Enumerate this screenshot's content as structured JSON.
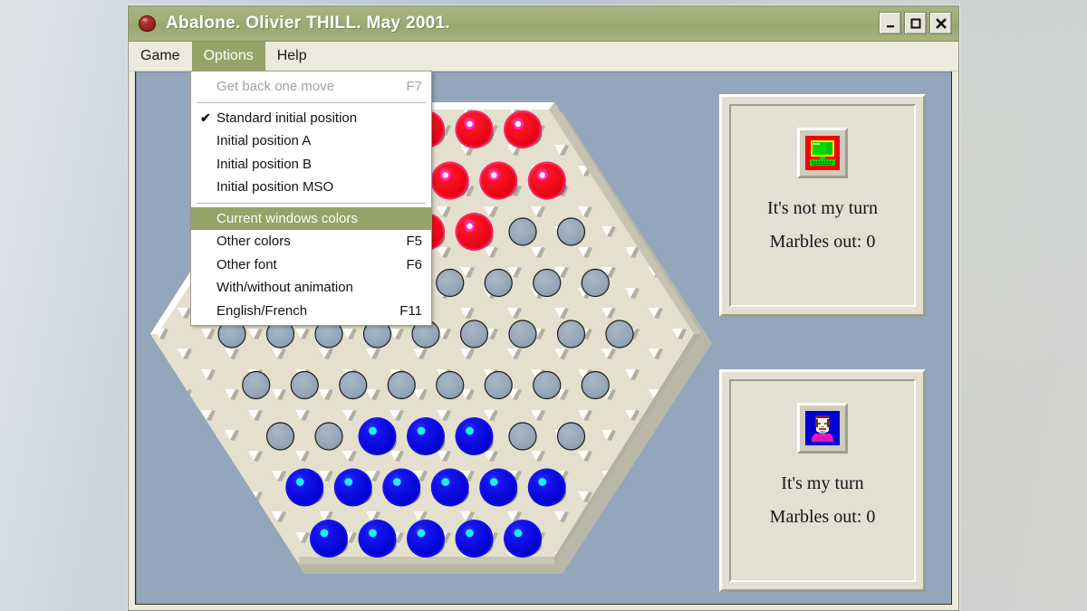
{
  "window": {
    "title": "Abalone. Olivier THILL. May 2001.",
    "title_icon": "marble-icon",
    "controls": {
      "minimize": "minimize-icon",
      "maximize": "maximize-icon",
      "close": "close-icon"
    }
  },
  "menubar": {
    "items": [
      {
        "label": "Game",
        "active": false
      },
      {
        "label": "Options",
        "active": true
      },
      {
        "label": "Help",
        "active": false
      }
    ]
  },
  "dropdown": {
    "owner": "Options",
    "highlight_color": "#95a369",
    "items": [
      {
        "label": "Get back one move",
        "accel": "F7",
        "disabled": true,
        "checked": false,
        "selected": false
      },
      {
        "separator": true
      },
      {
        "label": "Standard initial position",
        "accel": "",
        "disabled": false,
        "checked": true,
        "selected": false
      },
      {
        "label": "Initial position A",
        "accel": "",
        "disabled": false,
        "checked": false,
        "selected": false
      },
      {
        "label": "Initial position B",
        "accel": "",
        "disabled": false,
        "checked": false,
        "selected": false
      },
      {
        "label": "Initial position MSO",
        "accel": "",
        "disabled": false,
        "checked": false,
        "selected": false
      },
      {
        "separator": true
      },
      {
        "label": "Current windows colors",
        "accel": "",
        "disabled": false,
        "checked": false,
        "selected": true
      },
      {
        "label": "Other colors",
        "accel": "F5",
        "disabled": false,
        "checked": false,
        "selected": false
      },
      {
        "label": "Other font",
        "accel": "F6",
        "disabled": false,
        "checked": false,
        "selected": false
      },
      {
        "label": "With/without animation",
        "accel": "",
        "disabled": false,
        "checked": false,
        "selected": false
      },
      {
        "label": "English/French",
        "accel": "F11",
        "disabled": false,
        "checked": false,
        "selected": false
      }
    ]
  },
  "panels": {
    "opponent": {
      "icon": "computer-icon",
      "turn_text": "It's not my turn",
      "marbles_text": "Marbles out: 0"
    },
    "player": {
      "icon": "person-icon",
      "turn_text": "It's my turn",
      "marbles_text": "Marbles out: 0"
    }
  },
  "colors": {
    "title_bar": "#9fad76",
    "menu_highlight": "#95a369",
    "client_background": "#93a6bb",
    "board_surface": "#e4e0cd",
    "empty_slot": "#93a4b5",
    "red_marble": "#fb0512",
    "blue_marble": "#0a0ae8",
    "panel_face": "#e3e0d2"
  },
  "board": {
    "rows": [
      {
        "index": 0,
        "count": 5,
        "cells": [
          "red",
          "red",
          "red",
          "red",
          "red"
        ]
      },
      {
        "index": 1,
        "count": 6,
        "cells": [
          "red",
          "red",
          "red",
          "red",
          "red",
          "red"
        ]
      },
      {
        "index": 2,
        "count": 7,
        "cells": [
          "red",
          "red",
          "red",
          "red",
          "red",
          "empty",
          "empty"
        ]
      },
      {
        "index": 3,
        "count": 8,
        "cells": [
          "empty",
          "empty",
          "empty",
          "empty",
          "empty",
          "empty",
          "empty",
          "empty"
        ]
      },
      {
        "index": 4,
        "count": 9,
        "cells": [
          "empty",
          "empty",
          "empty",
          "empty",
          "empty",
          "empty",
          "empty",
          "empty",
          "empty"
        ]
      },
      {
        "index": 5,
        "count": 8,
        "cells": [
          "empty",
          "empty",
          "empty",
          "empty",
          "empty",
          "empty",
          "empty",
          "empty"
        ]
      },
      {
        "index": 6,
        "count": 7,
        "cells": [
          "empty",
          "empty",
          "blue",
          "blue",
          "blue",
          "empty",
          "empty"
        ]
      },
      {
        "index": 7,
        "count": 6,
        "cells": [
          "blue",
          "blue",
          "blue",
          "blue",
          "blue",
          "blue"
        ]
      },
      {
        "index": 8,
        "count": 5,
        "cells": [
          "blue",
          "blue",
          "blue",
          "blue",
          "blue"
        ]
      }
    ]
  }
}
